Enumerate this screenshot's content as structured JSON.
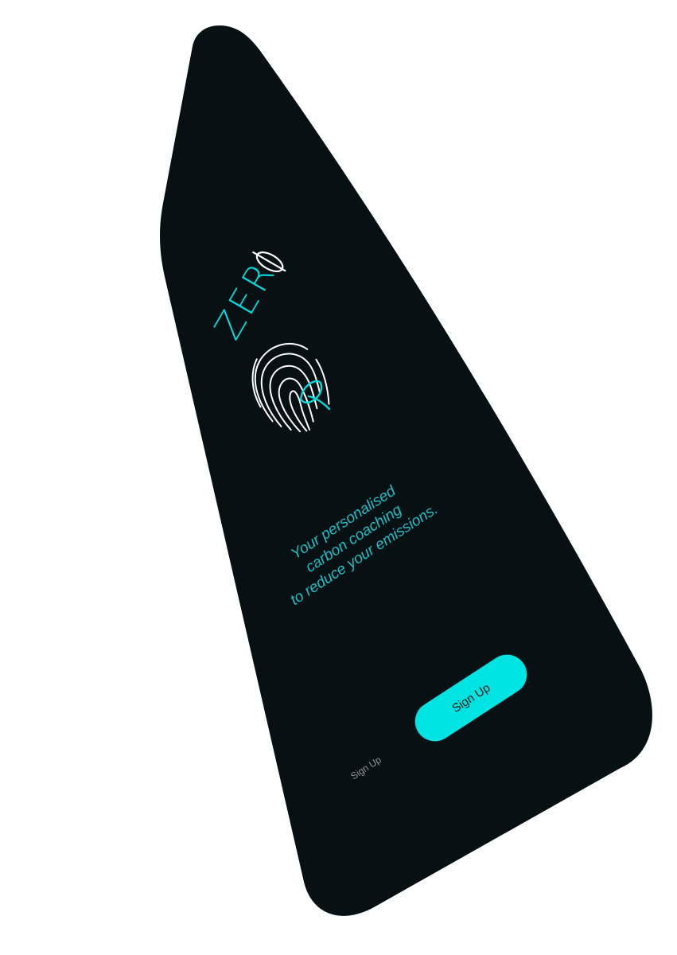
{
  "app": {
    "logo_text": "ZER",
    "logo_icon": "fingerprint-leaf-icon",
    "background_color": "#071012",
    "accent_color": "#00e3e3"
  },
  "tagline": {
    "line1": "Your personalised",
    "line2": "carbon coaching",
    "line3": "to reduce your emissions."
  },
  "actions": {
    "primary_label": "Sign Up",
    "secondary_label": "Sign Up"
  }
}
